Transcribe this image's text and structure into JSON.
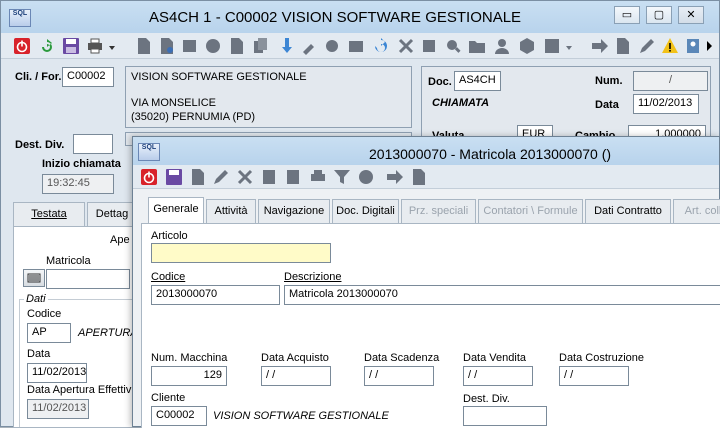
{
  "main_window": {
    "title": "AS4CH 1 - C00002 VISION SOFTWARE GESTIONALE",
    "logo_text": "SQL",
    "window_buttons": {
      "minimize": "▭",
      "maximize": "▢",
      "close": "✕"
    },
    "header": {
      "cli_for_label": "Cli. / For.",
      "cli_for_value": "C00002",
      "address_line1": "VISION SOFTWARE GESTIONALE",
      "address_line2": "VIA MONSELICE",
      "address_line3": "(35020)  PERNUMIA (PD)",
      "doc_label": "Doc.",
      "doc_value": "AS4CH",
      "num_label": "Num.",
      "num_value": "/",
      "doc_type": "CHIAMATA",
      "data_label": "Data",
      "data_value": "11/02/2013",
      "valuta_label": "Valuta",
      "valuta_value": "EUR",
      "cambio_label": "Cambio",
      "cambio_value": "1,000000",
      "dest_div_label": "Dest. Div.",
      "inizio_chiamata_label": "Inizio chiamata",
      "inizio_chiamata_value": "19:32:45"
    },
    "tabs": [
      "Testata",
      "Dettag"
    ],
    "left_panel": {
      "aper_label": "Ape",
      "matricola_label": "Matricola",
      "dati_group": "Dati",
      "codice_label": "Codice",
      "codice_value": "AP",
      "codice_desc": "APERTURA",
      "data_label": "Data",
      "data_value": "11/02/2013",
      "data_apertura_label": "Data Apertura Effettiv",
      "data_apertura_value": "11/02/2013"
    }
  },
  "dialog": {
    "title": "2013000070 - Matricola 2013000070 ()",
    "logo_text": "SQL",
    "tabs": [
      {
        "label": "Generale",
        "state": "active"
      },
      {
        "label": "Attività",
        "state": "normal"
      },
      {
        "label": "Navigazione",
        "state": "normal"
      },
      {
        "label": "Doc. Digitali",
        "state": "normal"
      },
      {
        "label": "Prz. speciali",
        "state": "disabled"
      },
      {
        "label": "Contatori \\ Formule",
        "state": "disabled"
      },
      {
        "label": "Dati Contratto",
        "state": "normal"
      },
      {
        "label": "Art. coll",
        "state": "disabled"
      }
    ],
    "articolo_label": "Articolo",
    "articolo_value": "",
    "codice_label": "Codice",
    "codice_value": "2013000070",
    "descrizione_label": "Descrizione",
    "descrizione_value": "Matricola 2013000070",
    "num_macchina_label": "Num. Macchina",
    "num_macchina_value": "129",
    "data_acquisto_label": "Data Acquisto",
    "data_acquisto_value": " / /",
    "data_scadenza_label": "Data Scadenza",
    "data_scadenza_value": " / /",
    "data_vendita_label": "Data Vendita",
    "data_vendita_value": " / /",
    "data_costruzione_label": "Data Costruzione",
    "data_costruzione_value": " / /",
    "cliente_label": "Cliente",
    "cliente_value": "C00002",
    "cliente_desc": "VISION SOFTWARE GESTIONALE",
    "dest_div_label": "Dest. Div.",
    "dest_div_value": ""
  },
  "colors": {
    "accent_yellow": "#fffbc8",
    "title_bar": "#c4dbf0",
    "tab_border": "#a9b6c3"
  }
}
